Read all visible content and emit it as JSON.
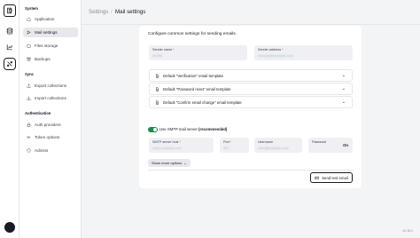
{
  "rail": {
    "icons": [
      "logo-icon",
      "database-icon",
      "chart-icon",
      "tools-icon"
    ],
    "active": "tools-icon"
  },
  "sidebar": {
    "sections": [
      {
        "heading": "System",
        "items": [
          "Application",
          "Mail settings",
          "Files storage",
          "Backups"
        ]
      },
      {
        "heading": "Sync",
        "items": [
          "Export collections",
          "Import collections"
        ]
      },
      {
        "heading": "Authentication",
        "items": [
          "Auth providers",
          "Token options",
          "Admins"
        ]
      }
    ],
    "active_item": "Mail settings"
  },
  "breadcrumb": {
    "parent": "Settings",
    "separator": "/",
    "current": "Mail settings"
  },
  "panel": {
    "intro": "Configure common settings for sending emails.",
    "sender_name": {
      "label": "Sender name",
      "value": "ACME"
    },
    "sender_address": {
      "label": "Sender address",
      "value": "noreply@example.com"
    },
    "templates": [
      "Default \"Verification\" email template",
      "Default \"Password reset\" email template",
      "Default \"Confirm email change\" email template"
    ],
    "smtp_toggle": {
      "prefix": "Use SMTP mail server",
      "emphasis": "(recommended)",
      "enabled": true
    },
    "smtp": {
      "server_host": {
        "label": "SMTP server host",
        "value": "smtp.example.com"
      },
      "port": {
        "label": "Port",
        "value": "587"
      },
      "username": {
        "label": "Username",
        "value": "user@example.com"
      },
      "password": {
        "label": "Password",
        "value": "",
        "reveal": "On"
      }
    },
    "more_options": "Show more options",
    "send_test": "Send test email"
  },
  "footer": "v0.16.x",
  "colors": {
    "toggle_on": "#1f8a4c",
    "required": "#e34562",
    "panel": "#ffffff",
    "background": "#f3f4f6"
  }
}
